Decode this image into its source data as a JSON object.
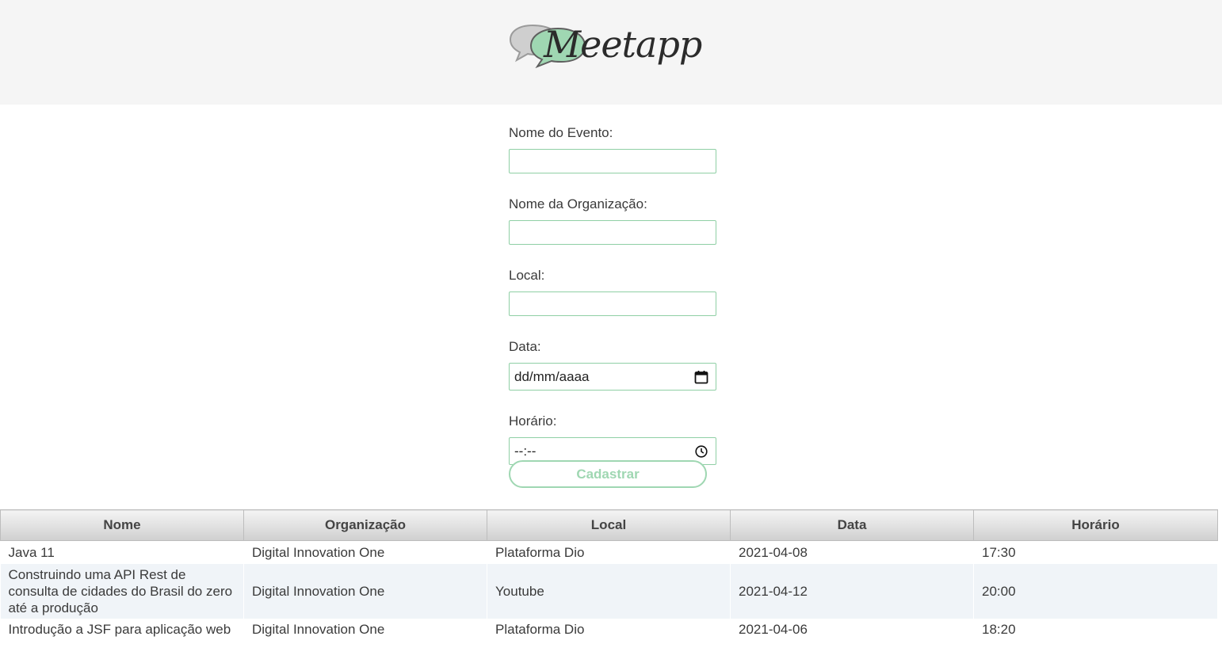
{
  "brand": {
    "name": "Meetapp",
    "colors": {
      "accent": "#9fd7b2",
      "bubble_green": "#9fd7b2",
      "bubble_gray": "#cfcfcf"
    }
  },
  "form": {
    "event_name_label": "Nome do Evento:",
    "event_name_value": "",
    "organization_label": "Nome da Organização:",
    "organization_value": "",
    "location_label": "Local:",
    "location_value": "",
    "date_label": "Data:",
    "date_value": "dd/mm/aaaa",
    "date_icon": "calendar-icon",
    "time_label": "Horário:",
    "time_value": "--:--",
    "time_icon": "clock-icon",
    "submit_label": "Cadastrar"
  },
  "table": {
    "columns": [
      "Nome",
      "Organização",
      "Local",
      "Data",
      "Horário"
    ],
    "rows": [
      [
        "Java 11",
        "Digital Innovation One",
        "Plataforma Dio",
        "2021-04-08",
        "17:30"
      ],
      [
        "Construindo uma API Rest de consulta de cidades do Brasil do zero até a produção",
        "Digital Innovation One",
        "Youtube",
        "2021-04-12",
        "20:00"
      ],
      [
        "Introdução a JSF para aplicação web",
        "Digital Innovation One",
        "Plataforma Dio",
        "2021-04-06",
        "18:20"
      ]
    ]
  }
}
